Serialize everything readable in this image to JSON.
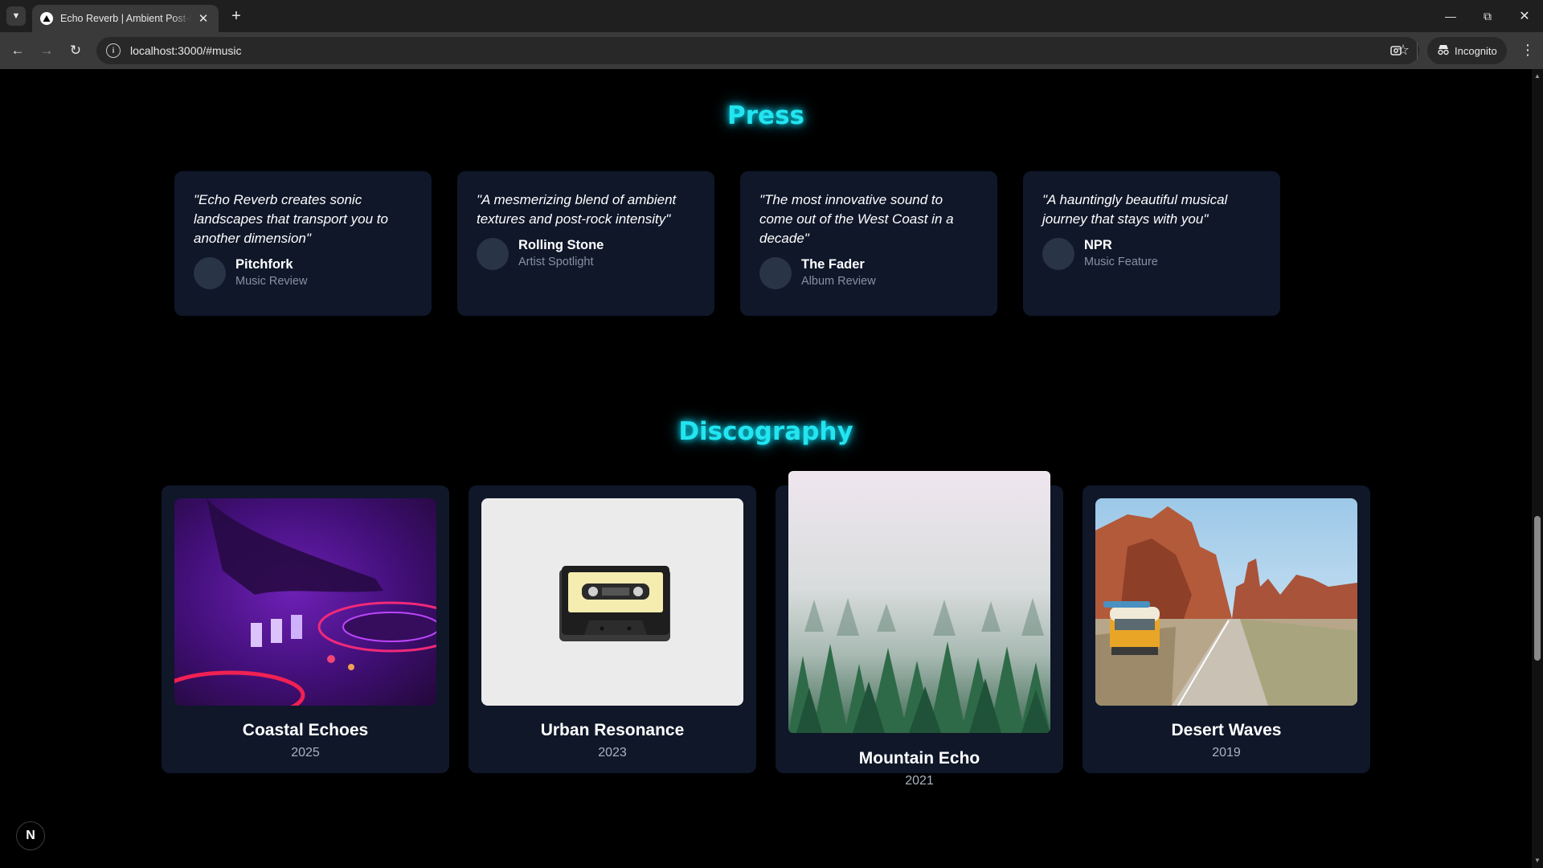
{
  "browser": {
    "tab_title": "Echo Reverb | Ambient Post-Rock",
    "url": "localhost:3000/#music",
    "incognito_label": "Incognito",
    "icons": {
      "tab_switcher": "chevron-down-icon",
      "favicon": "triangle-logo-icon",
      "tab_close": "close-icon",
      "new_tab": "plus-icon",
      "minimize": "minimize-icon",
      "restore": "restore-icon",
      "close_window": "close-icon",
      "back": "arrow-left-icon",
      "forward": "arrow-right-icon",
      "reload": "reload-icon",
      "site_info": "info-icon",
      "bookmark": "star-icon",
      "screenshot": "screenshot-icon",
      "incognito": "incognito-icon",
      "menu": "more-vertical-icon"
    }
  },
  "press": {
    "title": "Press",
    "items": [
      {
        "quote": "\"Echo Reverb creates sonic landscapes that transport you to another dimension\"",
        "source": "Pitchfork",
        "type": "Music Review"
      },
      {
        "quote": "\"A mesmerizing blend of ambient textures and post-rock intensity\"",
        "source": "Rolling Stone",
        "type": "Artist Spotlight"
      },
      {
        "quote": "\"The most innovative sound to come out of the West Coast in a decade\"",
        "source": "The Fader",
        "type": "Album Review"
      },
      {
        "quote": "\"A hauntingly beautiful musical journey that stays with you\"",
        "source": "NPR",
        "type": "Music Feature"
      }
    ]
  },
  "discography": {
    "title": "Discography",
    "albums": [
      {
        "title": "Coastal Echoes",
        "year": "2025",
        "art": "dj-turntable-purple"
      },
      {
        "title": "Urban Resonance",
        "year": "2023",
        "art": "cassette-tape"
      },
      {
        "title": "Mountain Echo",
        "year": "2021",
        "art": "misty-forest"
      },
      {
        "title": "Desert Waves",
        "year": "2019",
        "art": "desert-van-road"
      }
    ]
  },
  "dev_badge": {
    "label": "N"
  },
  "colors": {
    "accent": "#22e5f0",
    "card_bg": "#0f1729",
    "page_bg": "#000000"
  }
}
